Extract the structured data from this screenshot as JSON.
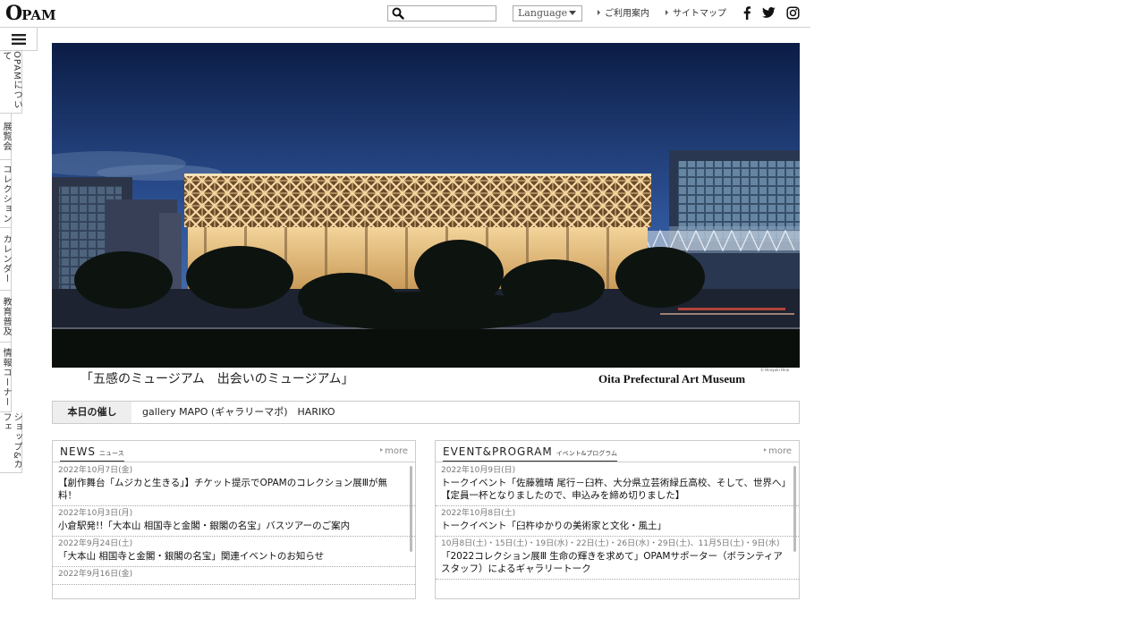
{
  "header": {
    "logo": {
      "main": "OPAM",
      "part1": "O",
      "part2": "P",
      "part3": "A",
      "part4": "M"
    },
    "search": {
      "placeholder": ""
    },
    "language": {
      "selected": "Language"
    },
    "links": [
      {
        "label": "ご利用案内"
      },
      {
        "label": "サイトマップ"
      }
    ],
    "social": [
      {
        "icon": "facebook-icon"
      },
      {
        "icon": "twitter-icon"
      },
      {
        "icon": "instagram-icon"
      }
    ]
  },
  "leftnav": {
    "menu_icon": "hamburger-icon",
    "items": [
      {
        "label": "OPAMについて"
      },
      {
        "label": "展覧会"
      },
      {
        "label": "コレクション"
      },
      {
        "label": "カレンダー"
      },
      {
        "label": "教育普及"
      },
      {
        "label": "情報コーナー"
      },
      {
        "label": "ショップ&カフェ"
      }
    ]
  },
  "hero": {
    "tagline": "「五感のミュージアム　出会いのミュージアム」",
    "museum_name": "Oita Prefectural Art Museum",
    "credit": "© Hiroyuki Hirai"
  },
  "today": {
    "label": "本日の催し",
    "value": "gallery MAPO (ギャラリーマポ)　HARIKO"
  },
  "news": {
    "title": "NEWS",
    "subtitle": "ニュース",
    "more": "more",
    "items": [
      {
        "date": "2022年10月7日(金)",
        "text": "【創作舞台「ムジカと生きる」】チケット提示でOPAMのコレクション展Ⅲが無料！"
      },
      {
        "date": "2022年10月3日(月)",
        "text": "小倉駅発!!「大本山 相国寺と金閣・銀閣の名宝」バスツアーのご案内"
      },
      {
        "date": "2022年9月24日(土)",
        "text": "「大本山 相国寺と金閣・銀閣の名宝」関連イベントのお知らせ"
      },
      {
        "date": "2022年9月16日(金)",
        "text": ""
      }
    ]
  },
  "events": {
    "title": "EVENT&PROGRAM",
    "subtitle": "イベント&プログラム",
    "more": "more",
    "items": [
      {
        "date": "2022年10月9日(日)",
        "text": "トークイベント「佐藤雅晴 尾行－臼杵、大分県立芸術緑丘高校、そして、世界へ」【定員一杯となりましたので、申込みを締め切りました】"
      },
      {
        "date": "2022年10月8日(土)",
        "text": "トークイベント「臼杵ゆかりの美術家と文化・風土」"
      },
      {
        "date": "10月8日(土)・15日(土)・19日(水)・22日(土)・26日(水)・29日(土)、11月5日(土)・9日(水)",
        "text": "「2022コレクション展Ⅲ 生命の輝きを求めて」OPAMサポーター（ボランティアスタッフ）によるギャラリートーク"
      }
    ]
  },
  "colors": {
    "sky_top": "#0c1f4a",
    "sky_bottom": "#3f66a8",
    "facade": "#e9c78e",
    "border": "#cccccc"
  }
}
